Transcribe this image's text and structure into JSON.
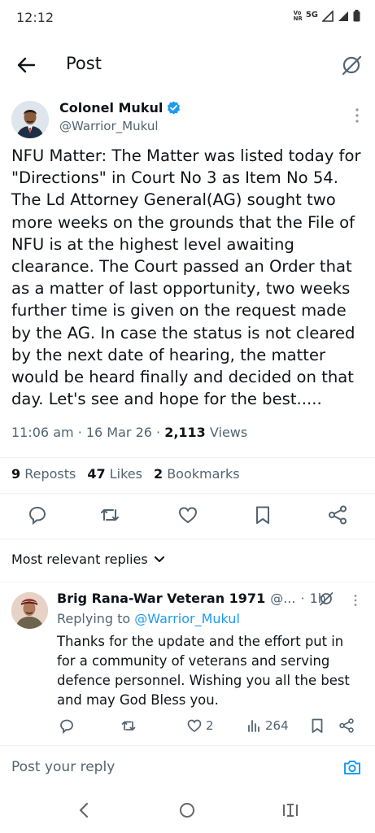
{
  "status_bar": {
    "time": "12:12",
    "carrier_top": "Vo",
    "carrier_bottom": "NR",
    "network": "5G"
  },
  "header": {
    "title": "Post",
    "back_icon": "arrow-left-icon",
    "grok_icon": "grok-icon"
  },
  "post": {
    "author_name": "Colonel Mukul",
    "author_handle": "@Warrior_Mukul",
    "text": "NFU Matter: The Matter was listed today for \"Directions\" in Court No 3 as Item No 54. The Ld Attorney General(AG) sought two more weeks on the grounds that the File of NFU is at the highest level awaiting clearance. The Court passed an Order that as a matter of last opportunity, two weeks further time is given on the request made by the AG. In case the status is not cleared by the next date of hearing, the matter would be heard finally and decided on that day. Let's see and hope for the best.....",
    "time": "11:06 am",
    "date": "16 Mar 26",
    "views_count": "2,113",
    "views_label": "Views",
    "reposts_count": "9",
    "reposts_label": "Reposts",
    "likes_count": "47",
    "likes_label": "Likes",
    "bookmarks_count": "2",
    "bookmarks_label": "Bookmarks"
  },
  "replies_sort": {
    "label": "Most relevant replies"
  },
  "reply": {
    "author_name": "Brig Rana-War Veteran 1971",
    "handle": "@...",
    "time": "1h",
    "replying_to_label": "Replying to",
    "replying_to_handle": "@Warrior_Mukul",
    "text": "Thanks for the update and the effort put in for a community of veterans and serving defence personnel. Wishing you all the best and may God Bless you.",
    "likes": "2",
    "views": "264"
  },
  "reply_bar": {
    "placeholder": "Post your reply"
  },
  "colors": {
    "accent": "#1d9bf0",
    "text": "#0f1419",
    "muted": "#536471",
    "divider": "#eff3f4"
  }
}
